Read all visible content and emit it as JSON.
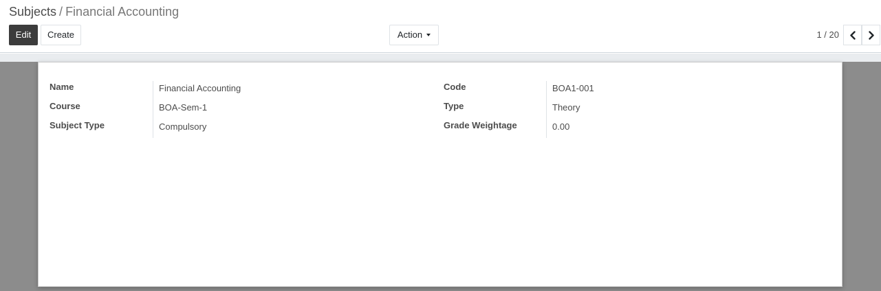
{
  "breadcrumb": {
    "parent": "Subjects",
    "separator": "/",
    "current": "Financial Accounting"
  },
  "toolbar": {
    "edit_label": "Edit",
    "create_label": "Create",
    "action_label": "Action"
  },
  "pager": {
    "value": "1 / 20"
  },
  "form": {
    "left_fields": [
      {
        "label": "Name",
        "value": "Financial Accounting"
      },
      {
        "label": "Course",
        "value": "BOA-Sem-1"
      },
      {
        "label": "Subject Type",
        "value": "Compulsory"
      }
    ],
    "right_fields": [
      {
        "label": "Code",
        "value": "BOA1-001"
      },
      {
        "label": "Type",
        "value": "Theory"
      },
      {
        "label": "Grade Weightage",
        "value": "0.00"
      }
    ]
  },
  "icons": {
    "prev": "chevron-left-icon",
    "next": "chevron-right-icon",
    "caret": "caret-down-icon"
  },
  "colors": {
    "primary_button": "#3c3c3c",
    "sheet_background": "#ffffff",
    "content_background": "#8c8c8c"
  }
}
